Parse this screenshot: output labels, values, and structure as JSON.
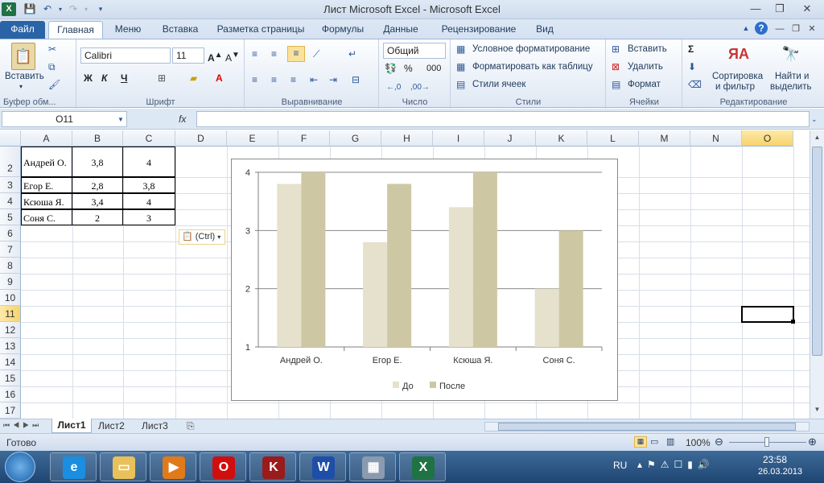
{
  "window": {
    "title": "Лист Microsoft Excel  -  Microsoft Excel",
    "minimize_icon": "minimize-icon",
    "maximize_icon": "restore-icon",
    "close_icon": "close-icon"
  },
  "tabs": [
    "Файл",
    "Главная",
    "Меню",
    "Вставка",
    "Разметка страницы",
    "Формулы",
    "Данные",
    "Рецензирование",
    "Вид"
  ],
  "ribbon": {
    "clipboard": {
      "label": "Буфер обм...",
      "paste": "Вставить"
    },
    "font": {
      "label": "Шрифт",
      "name": "Calibri",
      "size": "11",
      "bold": "Ж",
      "italic": "К",
      "underline": "Ч"
    },
    "alignment": {
      "label": "Выравнивание"
    },
    "number": {
      "label": "Число",
      "format": "Общий",
      "percent": "%",
      "thousands": "000"
    },
    "styles": {
      "label": "Стили",
      "conditional": "Условное форматирование",
      "as_table": "Форматировать как таблицу",
      "cell_styles": "Стили ячеек"
    },
    "cells": {
      "label": "Ячейки",
      "insert": "Вставить",
      "delete": "Удалить",
      "format": "Формат"
    },
    "editing": {
      "label": "Редактирование",
      "sort1": "Сортировка",
      "sort2": "и фильтр",
      "find1": "Найти и",
      "find2": "выделить",
      "sigma": "Σ"
    }
  },
  "formula_bar": {
    "name_box": "O11",
    "fx": "fx",
    "value": ""
  },
  "columns": [
    "A",
    "B",
    "C",
    "D",
    "E",
    "F",
    "G",
    "H",
    "I",
    "J",
    "K",
    "L",
    "M",
    "N",
    "O"
  ],
  "rows": [
    "2",
    "3",
    "4",
    "5",
    "6",
    "7",
    "8",
    "9",
    "10",
    "11",
    "12",
    "13",
    "14",
    "15",
    "16",
    "17"
  ],
  "table": [
    [
      "Андрей О.",
      "3,8",
      "4"
    ],
    [
      "Егор Е.",
      "2,8",
      "3,8"
    ],
    [
      "Ксюша Я.",
      "3,4",
      "4"
    ],
    [
      "Соня С.",
      "2",
      "3"
    ]
  ],
  "paste_options": "(Ctrl)",
  "chart_data": {
    "type": "bar",
    "categories": [
      "Андрей  О.",
      "Егор  Е.",
      "Ксюша  Я.",
      "Соня  С."
    ],
    "series": [
      {
        "name": "До",
        "values": [
          3.8,
          2.8,
          3.4,
          2
        ],
        "color": "#e5e1cc"
      },
      {
        "name": "После",
        "values": [
          4,
          3.8,
          4,
          3
        ],
        "color": "#cdc8a3"
      }
    ],
    "ylim": [
      1,
      4
    ],
    "yticks": [
      "1",
      "2",
      "3",
      "4"
    ],
    "grid": true,
    "legend": "bottom"
  },
  "sheets": [
    "Лист1",
    "Лист2",
    "Лист3"
  ],
  "status": {
    "ready": "Готово",
    "zoom": "100%"
  },
  "taskbar": {
    "lang": "RU",
    "time": "23:58",
    "date": "26.03.2013",
    "apps": [
      "ie-icon",
      "explorer-icon",
      "media-player-icon",
      "opera-icon",
      "kaspersky-icon",
      "word-icon",
      "calculator-icon",
      "excel-icon"
    ]
  }
}
